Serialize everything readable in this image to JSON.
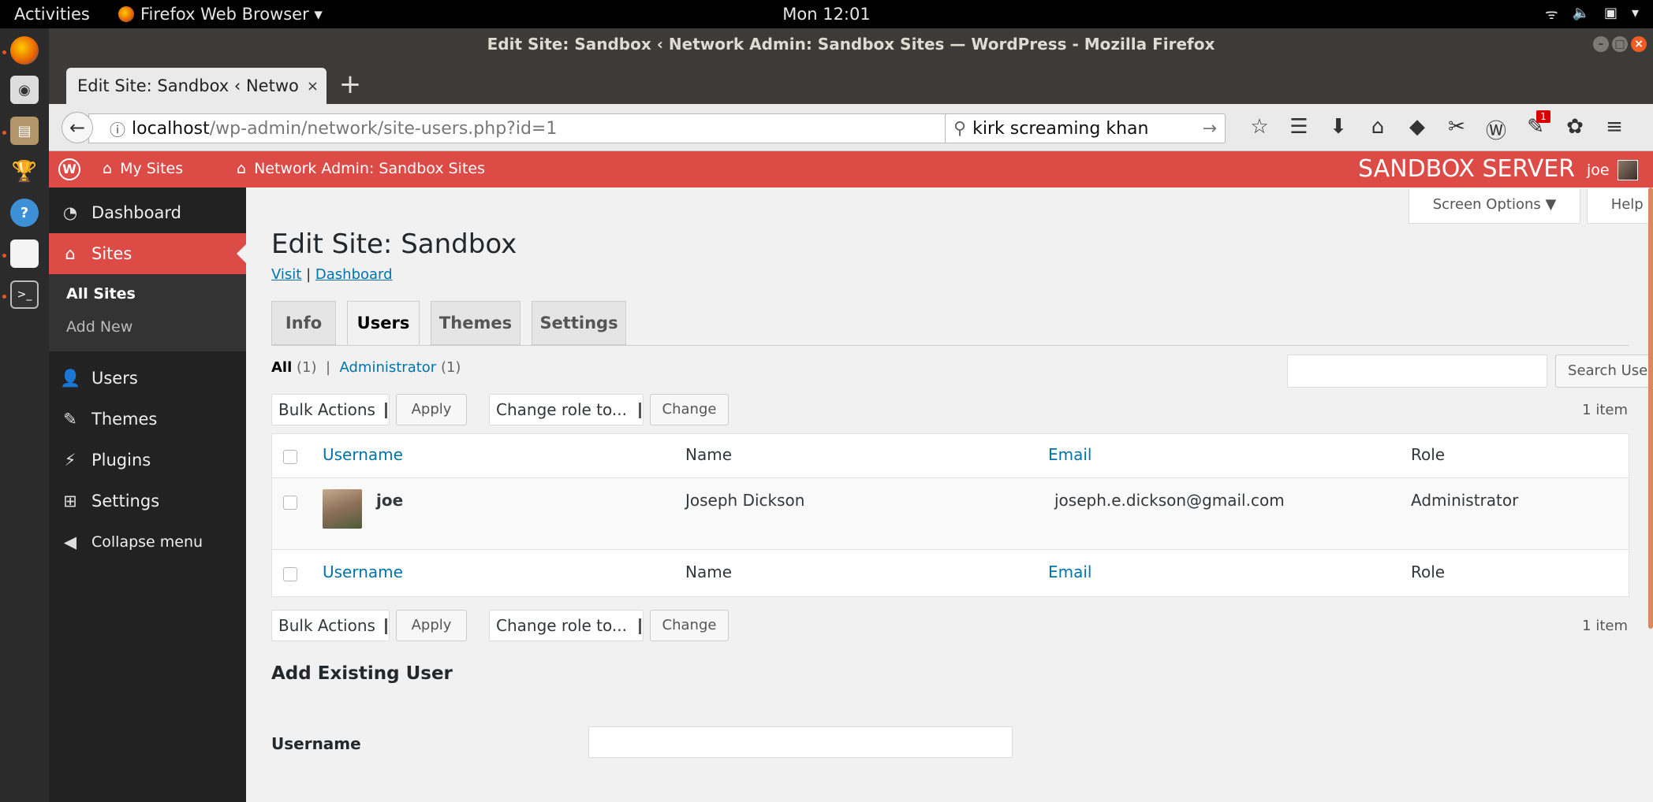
{
  "gnome": {
    "activities": "Activities",
    "app_name": "Firefox Web Browser ▾",
    "clock": "Mon 12:01",
    "tray": [
      "wifi-icon",
      "volume-icon",
      "power-icon",
      "menu-caret"
    ]
  },
  "dock": {
    "items": [
      "firefox-icon",
      "disks-icon",
      "files-icon",
      "trophy-icon",
      "help-icon",
      "document-icon",
      "terminal-icon"
    ]
  },
  "firefox": {
    "window_title": "Edit Site: Sandbox ‹ Network Admin: Sandbox Sites — WordPress - Mozilla Firefox",
    "tab_label": "Edit Site: Sandbox ‹ Netwo",
    "tab_close": "×",
    "newtab": "+",
    "url_host": "localhost",
    "url_path": "/wp-admin/network/site-users.php?id=1",
    "search_value": "kirk screaming khan",
    "badge_count": "1"
  },
  "adminbar": {
    "my_sites": "My Sites",
    "network_admin": "Network Admin: Sandbox Sites",
    "server": "SANDBOX SERVER",
    "user": "joe"
  },
  "sidebar": {
    "items": [
      {
        "label": "Dashboard",
        "icon": "dashboard-icon"
      },
      {
        "label": "Sites",
        "icon": "sites-icon"
      },
      {
        "label": "Users",
        "icon": "users-icon"
      },
      {
        "label": "Themes",
        "icon": "themes-icon"
      },
      {
        "label": "Plugins",
        "icon": "plugins-icon"
      },
      {
        "label": "Settings",
        "icon": "settings-icon"
      },
      {
        "label": "Collapse menu",
        "icon": "collapse-icon"
      }
    ],
    "sub_items": [
      "All Sites",
      "Add New"
    ]
  },
  "main": {
    "screen_options": "Screen Options ▼",
    "help": "Help ▼",
    "title": "Edit Site: Sandbox",
    "visit": "Visit",
    "sep": "|",
    "dashboard": "Dashboard",
    "tabs": [
      "Info",
      "Users",
      "Themes",
      "Settings"
    ],
    "filter_all": "All",
    "filter_all_count": "(1)",
    "filter_sep": "|",
    "filter_admin": "Administrator",
    "filter_admin_count": "(1)",
    "search_button": "Search Users",
    "bulk_actions": "Bulk Actions",
    "apply": "Apply",
    "change_role": "Change role to...",
    "change": "Change",
    "item_count": "1 item"
  },
  "table": {
    "columns": [
      "Username",
      "Name",
      "Email",
      "Role"
    ],
    "rows": [
      {
        "username": "joe",
        "name": "Joseph Dickson",
        "email": "joseph.e.dickson@gmail.com",
        "role": "Administrator"
      }
    ]
  },
  "add_existing": {
    "title": "Add Existing User",
    "username_label": "Username"
  }
}
